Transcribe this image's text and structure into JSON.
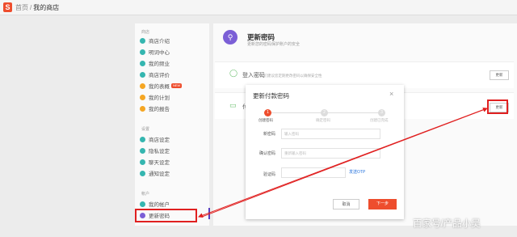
{
  "topbar": {
    "home": "首页",
    "separator": "/",
    "current": "我的商店",
    "logo_glyph": "S"
  },
  "sidebar": {
    "groups": [
      {
        "heading": "商店",
        "items": [
          {
            "label": "商店介绍",
            "color": "#35b6b0"
          },
          {
            "label": "明词中心",
            "color": "#35b6b0"
          },
          {
            "label": "我的频业",
            "color": "#35b6b0"
          },
          {
            "label": "商店评价",
            "color": "#35b6b0"
          },
          {
            "label": "我的表概",
            "color": "#f5a623",
            "badge": "NEW"
          },
          {
            "label": "我的计划",
            "color": "#f5a623"
          },
          {
            "label": "我的报告",
            "color": "#f5a623"
          }
        ]
      },
      {
        "heading": "设置",
        "items": [
          {
            "label": "商店设定",
            "color": "#35b6b0"
          },
          {
            "label": "隐私设定",
            "color": "#35b6b0"
          },
          {
            "label": "聊天设定",
            "color": "#35b6b0"
          },
          {
            "label": "通知设定",
            "color": "#35b6b0"
          }
        ]
      },
      {
        "heading": "帐户",
        "items": [
          {
            "label": "我的帐户",
            "color": "#35b6b0"
          },
          {
            "label": "更新密码",
            "color": "#7b5fd6"
          }
        ]
      }
    ]
  },
  "main": {
    "title": "更新密码",
    "subtitle": "更新您的密码保护账户的安全",
    "rows": [
      {
        "label": "登入密码",
        "desc": "我们建议您定期更改密码以确保安全性",
        "button": "更新"
      },
      {
        "label": "付",
        "button": "更新"
      }
    ]
  },
  "modal": {
    "title": "更新付款密码",
    "close_icon": "close-icon",
    "steps": [
      {
        "num": "1",
        "label": "创建密码"
      },
      {
        "num": "2",
        "label": "确定密码"
      },
      {
        "num": "3",
        "label": "创建已完成"
      }
    ],
    "fields": [
      {
        "label": "新密码",
        "placeholder": "输入密码"
      },
      {
        "label": "确认密码",
        "placeholder": "重新输入密码"
      },
      {
        "label": "验证码",
        "placeholder": ""
      }
    ],
    "otp_label": "发送OTP",
    "cancel": "取消",
    "next": "下一步"
  },
  "watermark": "百家号/产品小吴",
  "colors": {
    "accent": "#ee4d2d",
    "annotation": "#e02020",
    "active": "#7b5fd6"
  }
}
